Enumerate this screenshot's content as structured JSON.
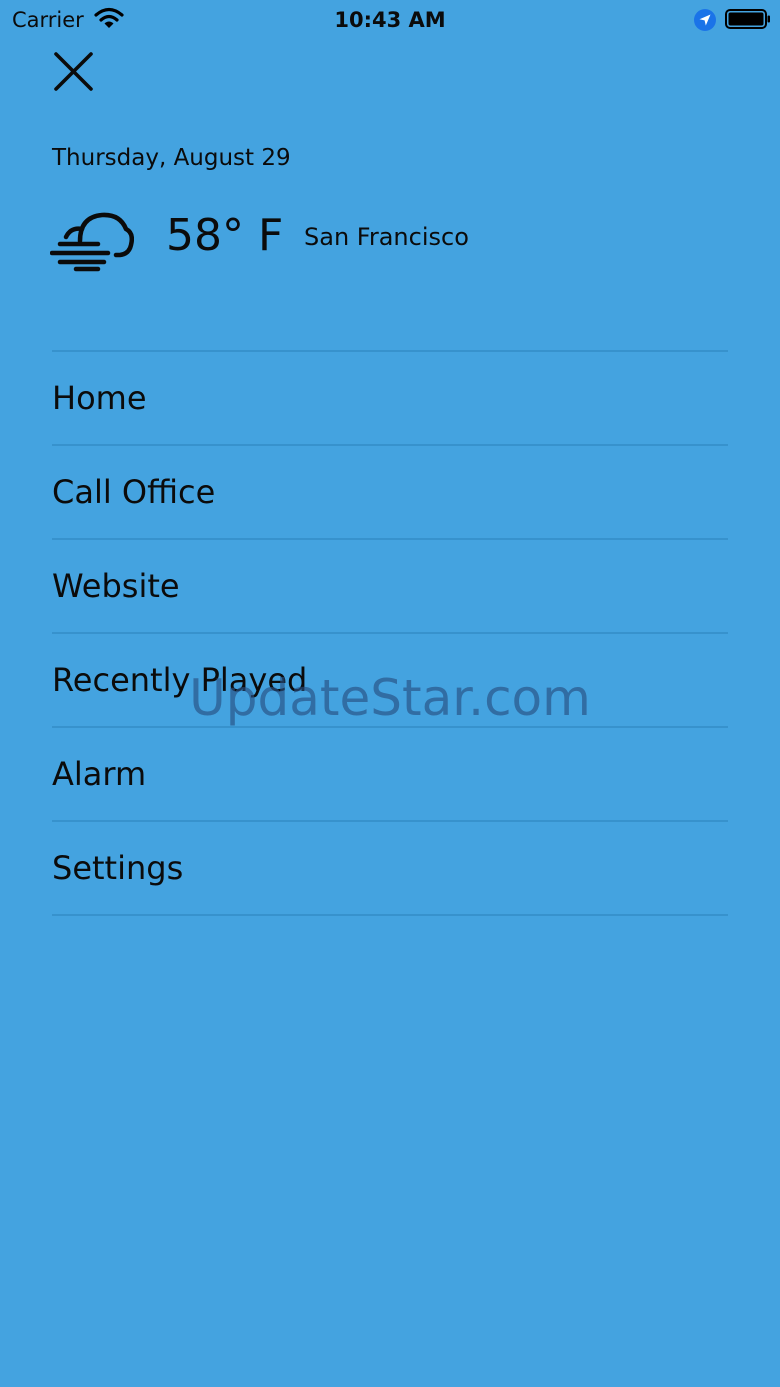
{
  "status_bar": {
    "carrier": "Carrier",
    "time": "10:43 AM",
    "icons": [
      "wifi-icon",
      "location-arrow-icon",
      "battery-icon"
    ]
  },
  "header": {
    "close_icon": "close-icon",
    "date": "Thursday, August 29",
    "weather_icon": "cloud-fog-icon",
    "temperature": "58° F",
    "city": "San Francisco"
  },
  "menu": {
    "items": [
      {
        "label": "Home"
      },
      {
        "label": "Call Office"
      },
      {
        "label": "Website"
      },
      {
        "label": "Recently Played"
      },
      {
        "label": "Alarm"
      },
      {
        "label": "Settings"
      }
    ]
  },
  "watermark": "UpdateStar.com",
  "colors": {
    "background": "#44a3e0",
    "text": "#0b0b0b",
    "location_accent": "#1a73e8"
  }
}
